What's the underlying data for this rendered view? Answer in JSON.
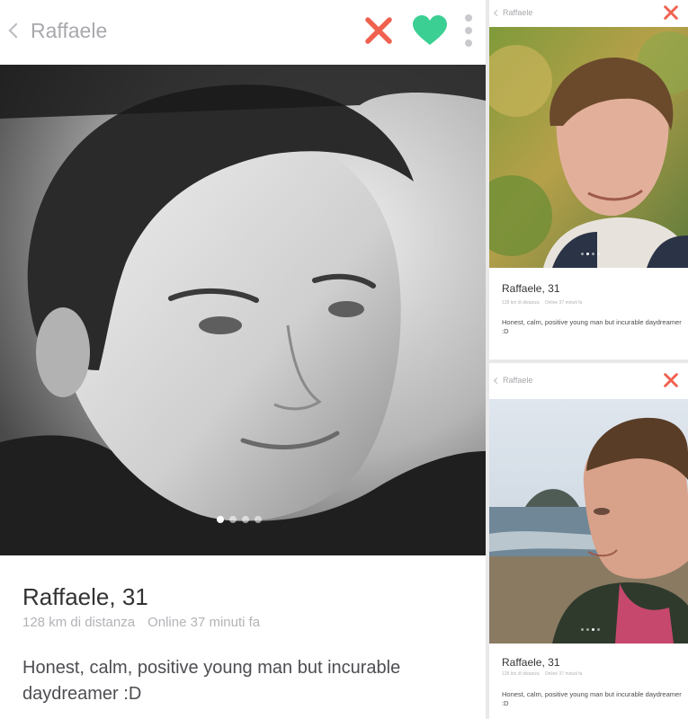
{
  "main": {
    "back_label": "Raffaele",
    "name_age": "Raffaele, 31",
    "distance": "128 km di distanza",
    "online": "Online 37 minuti fa",
    "bio": "Honest, calm, positive young man but incurable daydreamer :D",
    "photo_count": 4,
    "active_photo": 1
  },
  "side1": {
    "back_label": "Raffaele",
    "name_age": "Raffaele, 31",
    "distance": "128 km di distanza",
    "online": "Online 37 minuti fa",
    "bio": "Honest, calm, positive young man but incurable daydreamer :D",
    "photo_count": 4,
    "active_photo": 2
  },
  "side2": {
    "back_label": "Raffaele",
    "name_age": "Raffaele, 31",
    "distance": "128 km di distanza",
    "online": "Online 37 minuti fa",
    "bio": "Honest, calm, positive young man but incurable daydreamer :D",
    "photo_count": 4,
    "active_photo": 3
  },
  "icons": {
    "back": "chevron-left-icon",
    "dislike": "x-icon",
    "like": "heart-icon",
    "menu": "vertical-dots-icon"
  },
  "colors": {
    "dislike": "#f0614f",
    "like": "#3ccf93",
    "menu": "#c9c9ce"
  }
}
